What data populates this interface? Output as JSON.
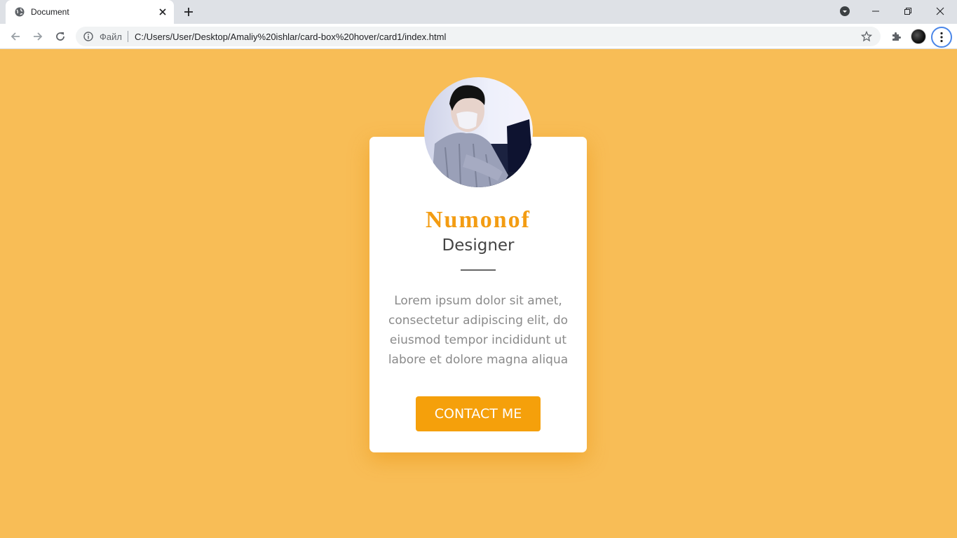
{
  "browser": {
    "tab": {
      "title": "Document",
      "favicon_icon": "globe-icon",
      "close_icon": "close-icon"
    },
    "new_tab_icon": "plus-icon",
    "window_controls": [
      "minimize-icon",
      "restore-icon",
      "close-icon"
    ],
    "profile_menu_icon": "chevron-down-icon",
    "address_bar": {
      "site_info_label": "Файл",
      "url": "C:/Users/User/Desktop/Amaliy%20ishlar/card-box%20hover/card1/index.html"
    }
  },
  "card": {
    "name": "Numonof",
    "role": "Designer",
    "description": "Lorem ipsum dolor sit amet, consectetur adipiscing elit, do eiusmod tempor incididunt ut labore et dolore magna aliqua",
    "button_label": "CONTACT ME"
  },
  "colors": {
    "page_background": "#f8bd56",
    "accent": "#f39c12",
    "button": "#f5a00b"
  }
}
